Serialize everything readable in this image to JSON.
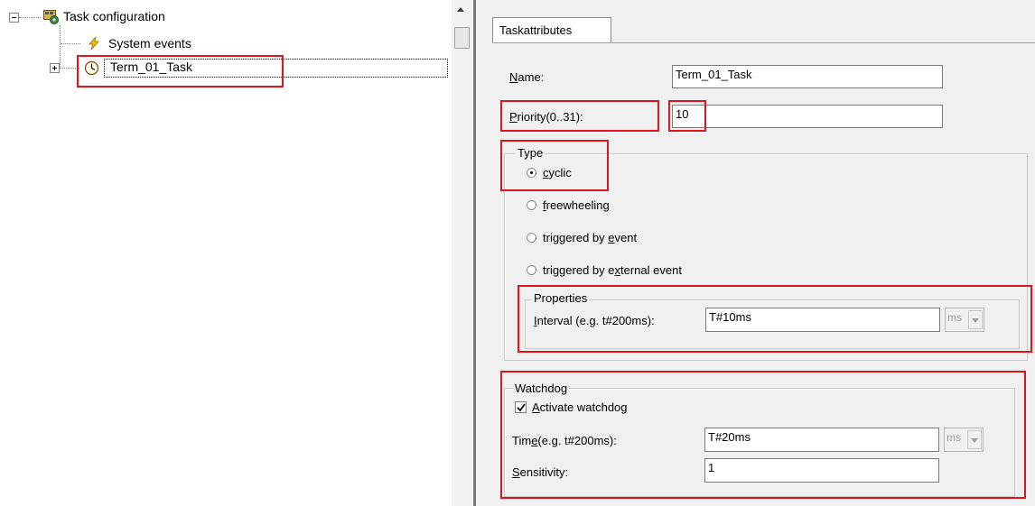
{
  "tree": {
    "root_label": "Task configuration",
    "items": [
      {
        "label": "System events",
        "icon": "lightning-bolt-icon"
      },
      {
        "label": "Term_01_Task",
        "icon": "clock-icon"
      }
    ]
  },
  "tabs": [
    {
      "label": "Taskattributes"
    }
  ],
  "attributes": {
    "name": {
      "label_accel": "N",
      "label_rest": "ame:",
      "value": "Term_01_Task"
    },
    "priority": {
      "label_accel": "P",
      "label_rest": "riority(0..31):",
      "value": "10"
    }
  },
  "type_group": {
    "title": "Type",
    "options": [
      {
        "pre": "",
        "accel": "c",
        "post": "yclic",
        "selected": true
      },
      {
        "pre": "",
        "accel": "f",
        "post": "reewheeling",
        "selected": false
      },
      {
        "pre": "triggered by ",
        "accel": "e",
        "post": "vent",
        "selected": false
      },
      {
        "pre": "triggered by e",
        "accel": "x",
        "post": "ternal event",
        "selected": false
      }
    ]
  },
  "properties_group": {
    "title": "Properties",
    "interval": {
      "label_accel": "I",
      "label_rest": "nterval (e.g. t#200ms):",
      "value": "T#10ms",
      "unit": "ms"
    }
  },
  "watchdog_group": {
    "title": "Watchdog",
    "activate": {
      "accel": "A",
      "rest": "ctivate watchdog",
      "checked": true
    },
    "time": {
      "pre": "Tim",
      "accel": "e",
      "post": "(e.g. t#200ms):",
      "value": "T#20ms",
      "unit": "ms"
    },
    "sensitivity": {
      "accel": "S",
      "rest": "ensitivity:",
      "value": "1"
    }
  },
  "colors": {
    "highlight_red": "#e0141e",
    "panel_bg": "#f0f0f0"
  }
}
